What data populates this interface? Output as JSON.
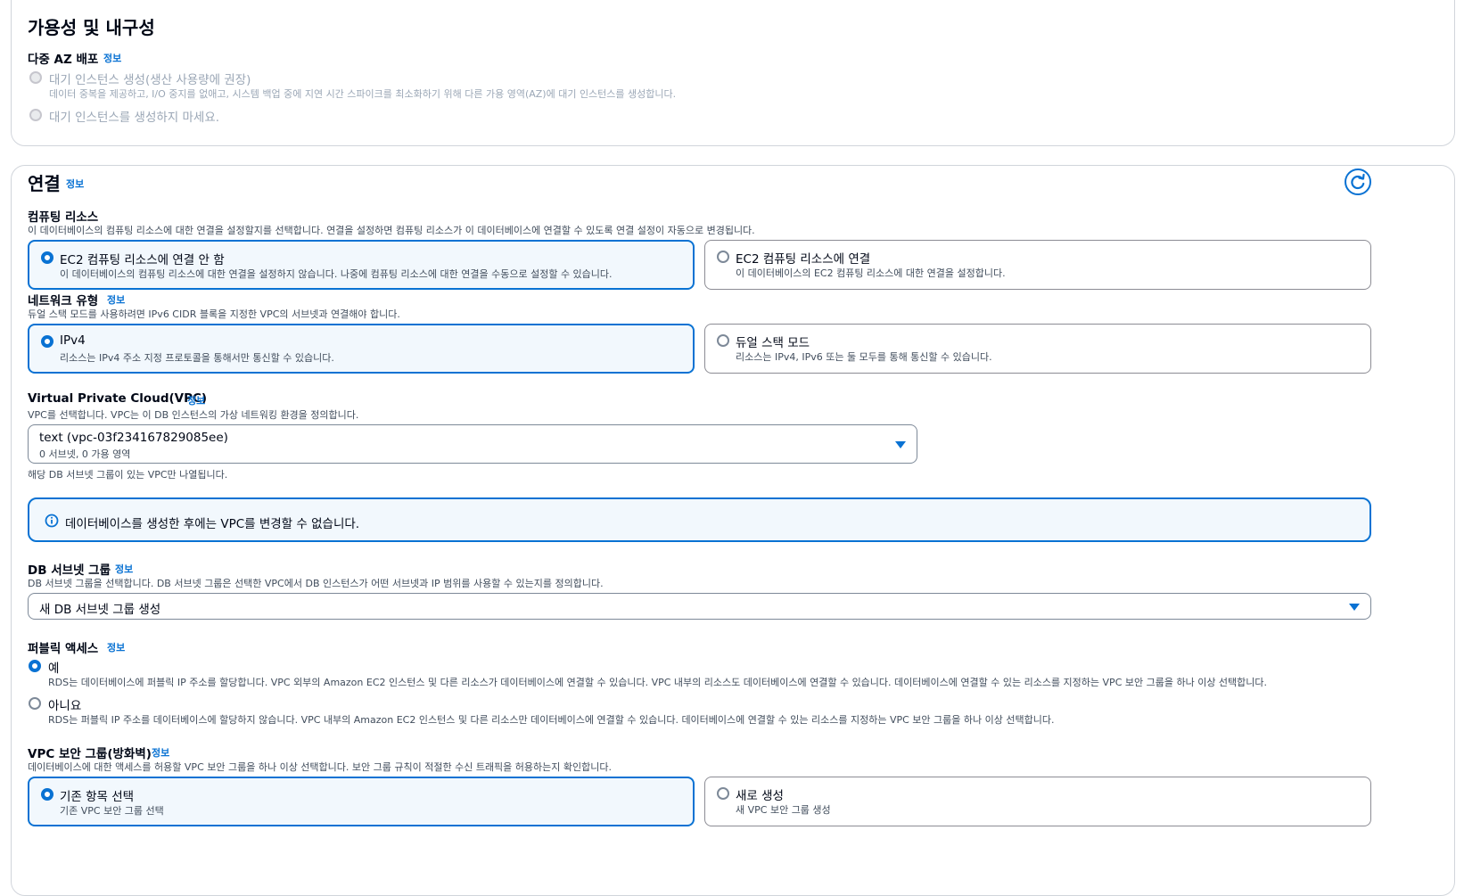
{
  "availability": {
    "title": "가용성 및 내구성",
    "multi_az_label": "다중 AZ 배포",
    "info": "정보",
    "options": [
      {
        "label": "대기 인스턴스 생성(생산 사용량에 권장)",
        "description": "데이터 중복을 제공하고, I/O 중지를 없애고, 시스템 백업 중에 지연 시간 스파이크를 최소화하기 위해 다른 가용 영역(AZ)에 대기 인스턴스를 생성합니다."
      },
      {
        "label": "대기 인스턴스를 생성하지 마세요."
      }
    ]
  },
  "connectivity": {
    "title": "연결",
    "info": "정보",
    "compute": {
      "label": "컴퓨팅 리소스",
      "description": "이 데이터베이스의 컴퓨팅 리소스에 대한 연결을 설정할지를 선택합니다. 연결을 설정하면 컴퓨팅 리소스가 이 데이터베이스에 연결할 수 있도록 연결 설정이 자동으로 변경됩니다.",
      "options": [
        {
          "label": "EC2 컴퓨팅 리소스에 연결 안 함",
          "description": "이 데이터베이스의 컴퓨팅 리소스에 대한 연결을 설정하지 않습니다. 나중에 컴퓨팅 리소스에 대한 연결을 수동으로 설정할 수 있습니다.",
          "selected": true
        },
        {
          "label": "EC2 컴퓨팅 리소스에 연결",
          "description": "이 데이터베이스의 EC2 컴퓨팅 리소스에 대한 연결을 설정합니다.",
          "selected": false
        }
      ]
    },
    "network": {
      "label": "네트워크 유형",
      "info": "정보",
      "description": "듀얼 스택 모드를 사용하려면 IPv6 CIDR 블록을 지정한 VPC의 서브넷과 연결해야 합니다.",
      "options": [
        {
          "label": "IPv4",
          "description": "리소스는 IPv4 주소 지정 프로토콜을 통해서만 통신할 수 있습니다.",
          "selected": true
        },
        {
          "label": "듀얼 스택 모드",
          "description": "리소스는 IPv4, IPv6 또는 둘 모두를 통해 통신할 수 있습니다.",
          "selected": false
        }
      ]
    },
    "vpc": {
      "label": "Virtual Private Cloud(VPC)",
      "info": "정보",
      "description": "VPC를 선택합니다. VPC는 이 DB 인스턴스의 가상 네트워킹 환경을 정의합니다.",
      "selected_value": "text (vpc-03f234167829085ee)",
      "selected_detail": "0 서브넷, 0 가용 영역",
      "hint": "해당 DB 서브넷 그룹이 있는 VPC만 나열됩니다."
    },
    "alert": "데이터베이스를 생성한 후에는 VPC를 변경할 수 없습니다.",
    "subnet": {
      "label": "DB 서브넷 그룹",
      "info": "정보",
      "description": "DB 서브넷 그룹을 선택합니다. DB 서브넷 그룹은 선택한 VPC에서 DB 인스턴스가 어떤 서브넷과 IP 범위를 사용할 수 있는지를 정의합니다.",
      "selected_value": "새 DB 서브넷 그룹 생성"
    },
    "public_access": {
      "label": "퍼블릭 액세스",
      "info": "정보",
      "options": [
        {
          "label": "예",
          "description": "RDS는 데이터베이스에 퍼블릭 IP 주소를 할당합니다. VPC 외부의 Amazon EC2 인스턴스 및 다른 리소스가 데이터베이스에 연결할 수 있습니다. VPC 내부의 리소스도 데이터베이스에 연결할 수 있습니다. 데이터베이스에 연결할 수 있는 리소스를 지정하는 VPC 보안 그룹을 하나 이상 선택합니다.",
          "selected": true
        },
        {
          "label": "아니요",
          "description": "RDS는 퍼블릭 IP 주소를 데이터베이스에 할당하지 않습니다. VPC 내부의 Amazon EC2 인스턴스 및 다른 리소스만 데이터베이스에 연결할 수 있습니다. 데이터베이스에 연결할 수 있는 리소스를 지정하는 VPC 보안 그룹을 하나 이상 선택합니다.",
          "selected": false
        }
      ]
    },
    "security_group": {
      "label": "VPC 보안 그룹(방화벽)",
      "info": "정보",
      "description": "데이터베이스에 대한 액세스를 허용할 VPC 보안 그룹을 하나 이상 선택합니다. 보안 그룹 규칙이 적절한 수신 트래픽을 허용하는지 확인합니다.",
      "options": [
        {
          "label": "기존 항목 선택",
          "description": "기존 VPC 보안 그룹 선택",
          "selected": true
        },
        {
          "label": "새로 생성",
          "description": "새 VPC 보안 그룹 생성",
          "selected": false
        }
      ]
    }
  },
  "colors": {
    "accent": "#0972d3",
    "selected_bg": "#f2f8fd",
    "border": "#8c8c94"
  }
}
